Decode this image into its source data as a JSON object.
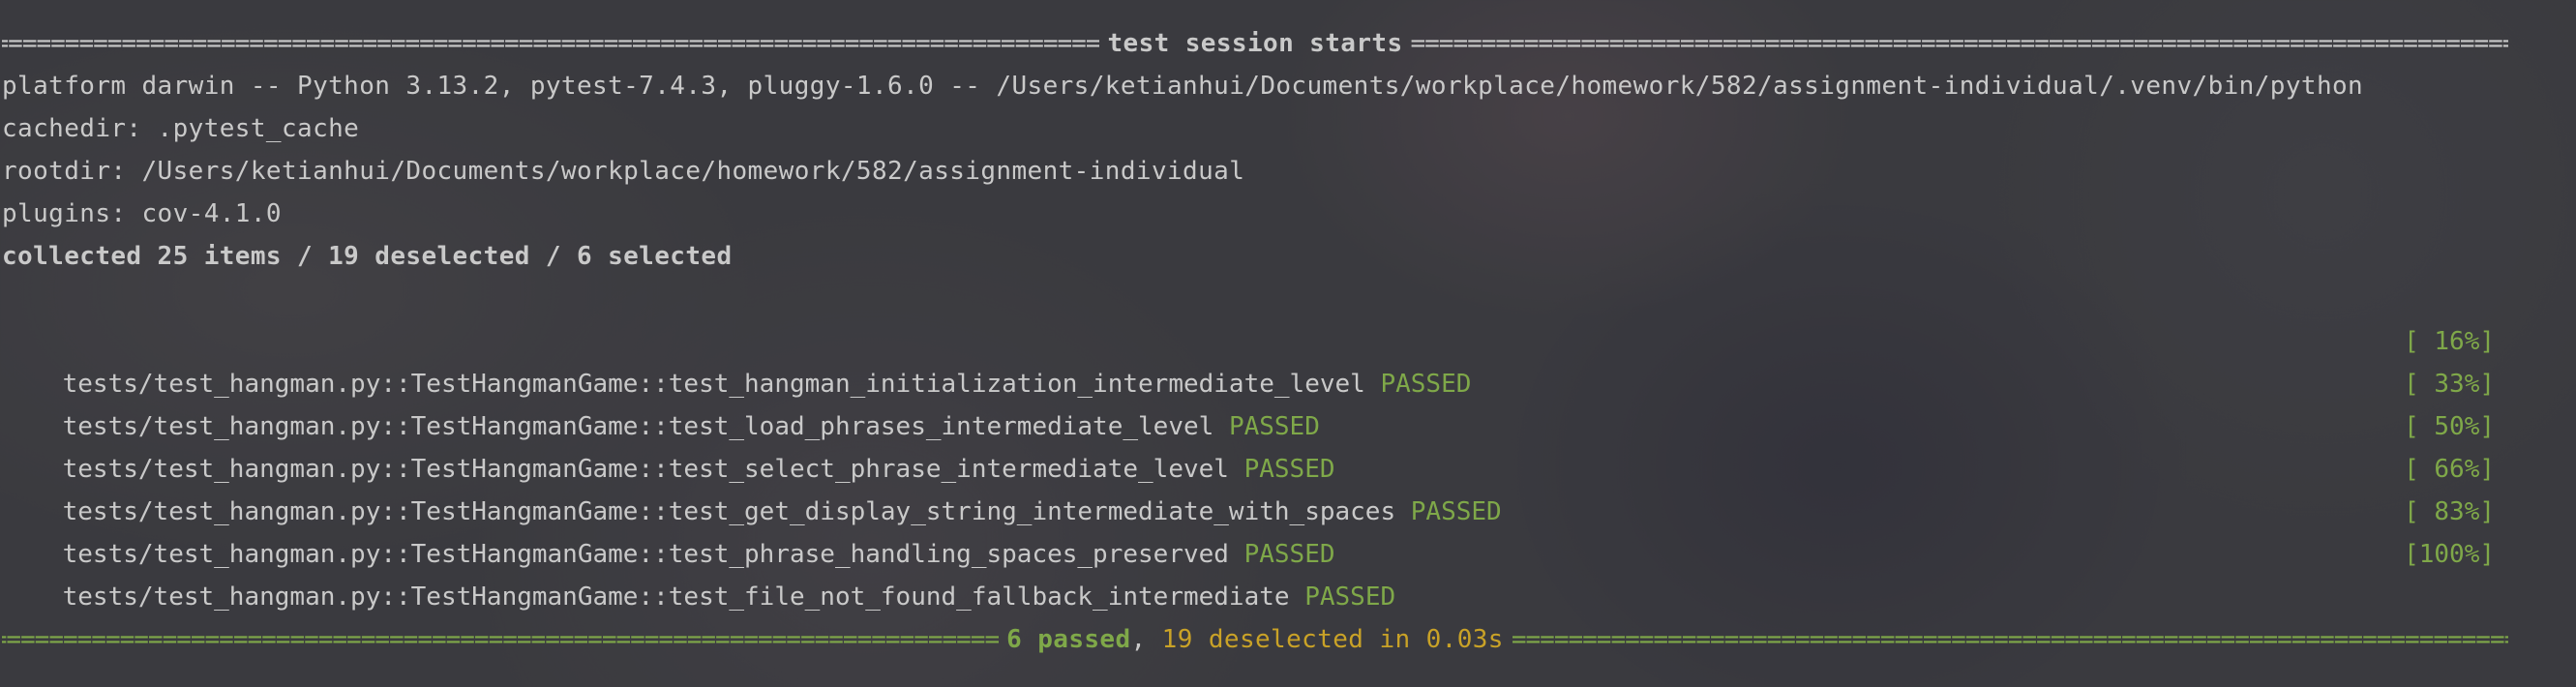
{
  "header": {
    "title": "test session starts"
  },
  "info_lines": {
    "platform": "platform darwin -- Python 3.13.2, pytest-7.4.3, pluggy-1.6.0 -- /Users/ketianhui/Documents/workplace/homework/582/assignment-individual/.venv/bin/python",
    "cachedir": "cachedir: .pytest_cache",
    "rootdir": "rootdir: /Users/ketianhui/Documents/workplace/homework/582/assignment-individual",
    "plugins": "plugins: cov-4.1.0",
    "collected": "collected 25 items / 19 deselected / 6 selected"
  },
  "tests": [
    {
      "id": "tests/test_hangman.py::TestHangmanGame::test_hangman_initialization_intermediate_level",
      "status": "PASSED",
      "progress": "[ 16%]"
    },
    {
      "id": "tests/test_hangman.py::TestHangmanGame::test_load_phrases_intermediate_level",
      "status": "PASSED",
      "progress": "[ 33%]"
    },
    {
      "id": "tests/test_hangman.py::TestHangmanGame::test_select_phrase_intermediate_level",
      "status": "PASSED",
      "progress": "[ 50%]"
    },
    {
      "id": "tests/test_hangman.py::TestHangmanGame::test_get_display_string_intermediate_with_spaces",
      "status": "PASSED",
      "progress": "[ 66%]"
    },
    {
      "id": "tests/test_hangman.py::TestHangmanGame::test_phrase_handling_spaces_preserved",
      "status": "PASSED",
      "progress": "[ 83%]"
    },
    {
      "id": "tests/test_hangman.py::TestHangmanGame::test_file_not_found_fallback_intermediate",
      "status": "PASSED",
      "progress": "[100%]"
    }
  ],
  "summary": {
    "passed": "6 passed",
    "separator": ",",
    "deselected": "19 deselected",
    "time": "in 0.03s"
  },
  "colors": {
    "passed": "#7fa849",
    "deselected": "#c9a227",
    "text": "#c9c9c9"
  }
}
